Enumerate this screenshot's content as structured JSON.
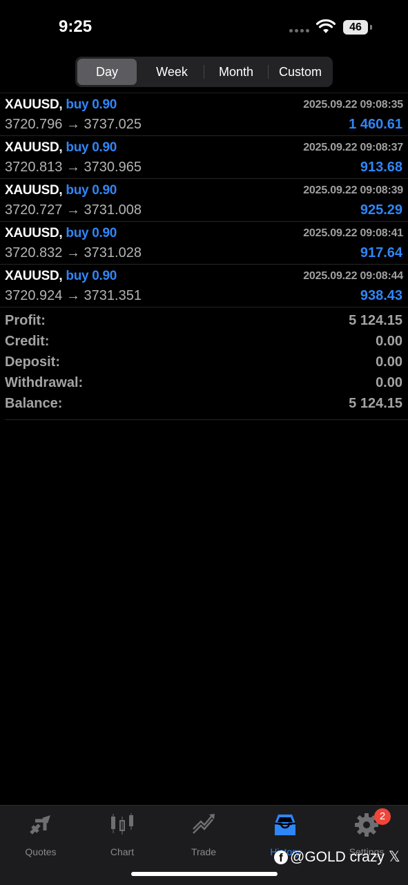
{
  "status_bar": {
    "time": "9:25",
    "battery": "46"
  },
  "periods": {
    "day": "Day",
    "week": "Week",
    "month": "Month",
    "custom": "Custom",
    "selected": "Day"
  },
  "deals": [
    {
      "symbol": "XAUUSD,",
      "action": "buy 0.90",
      "datetime": "2025.09.22 09:08:35",
      "prices": "3720.796 → 3737.025",
      "profit": "1 460.61"
    },
    {
      "symbol": "XAUUSD,",
      "action": "buy 0.90",
      "datetime": "2025.09.22 09:08:37",
      "prices": "3720.813 → 3730.965",
      "profit": "913.68"
    },
    {
      "symbol": "XAUUSD,",
      "action": "buy 0.90",
      "datetime": "2025.09.22 09:08:39",
      "prices": "3720.727 → 3731.008",
      "profit": "925.29"
    },
    {
      "symbol": "XAUUSD,",
      "action": "buy 0.90",
      "datetime": "2025.09.22 09:08:41",
      "prices": "3720.832 → 3731.028",
      "profit": "917.64"
    },
    {
      "symbol": "XAUUSD,",
      "action": "buy 0.90",
      "datetime": "2025.09.22 09:08:44",
      "prices": "3720.924 → 3731.351",
      "profit": "938.43"
    }
  ],
  "summary": {
    "profit": {
      "label": "Profit:",
      "value": "5 124.15"
    },
    "credit": {
      "label": "Credit:",
      "value": "0.00"
    },
    "deposit": {
      "label": "Deposit:",
      "value": "0.00"
    },
    "withdrawal": {
      "label": "Withdrawal:",
      "value": "0.00"
    },
    "balance": {
      "label": "Balance:",
      "value": "5 124.15"
    }
  },
  "tabs": {
    "quotes": "Quotes",
    "chart": "Chart",
    "trade": "Trade",
    "history": "History",
    "settings": "Settings",
    "active": "History",
    "settings_badge": "2"
  },
  "watermark": {
    "icon": "facebook-icon",
    "text": "@GOLD crazy",
    "glyph": "𝕏"
  },
  "colors": {
    "accent": "#2f86f7",
    "badge": "#f0453a",
    "background": "#000000"
  }
}
